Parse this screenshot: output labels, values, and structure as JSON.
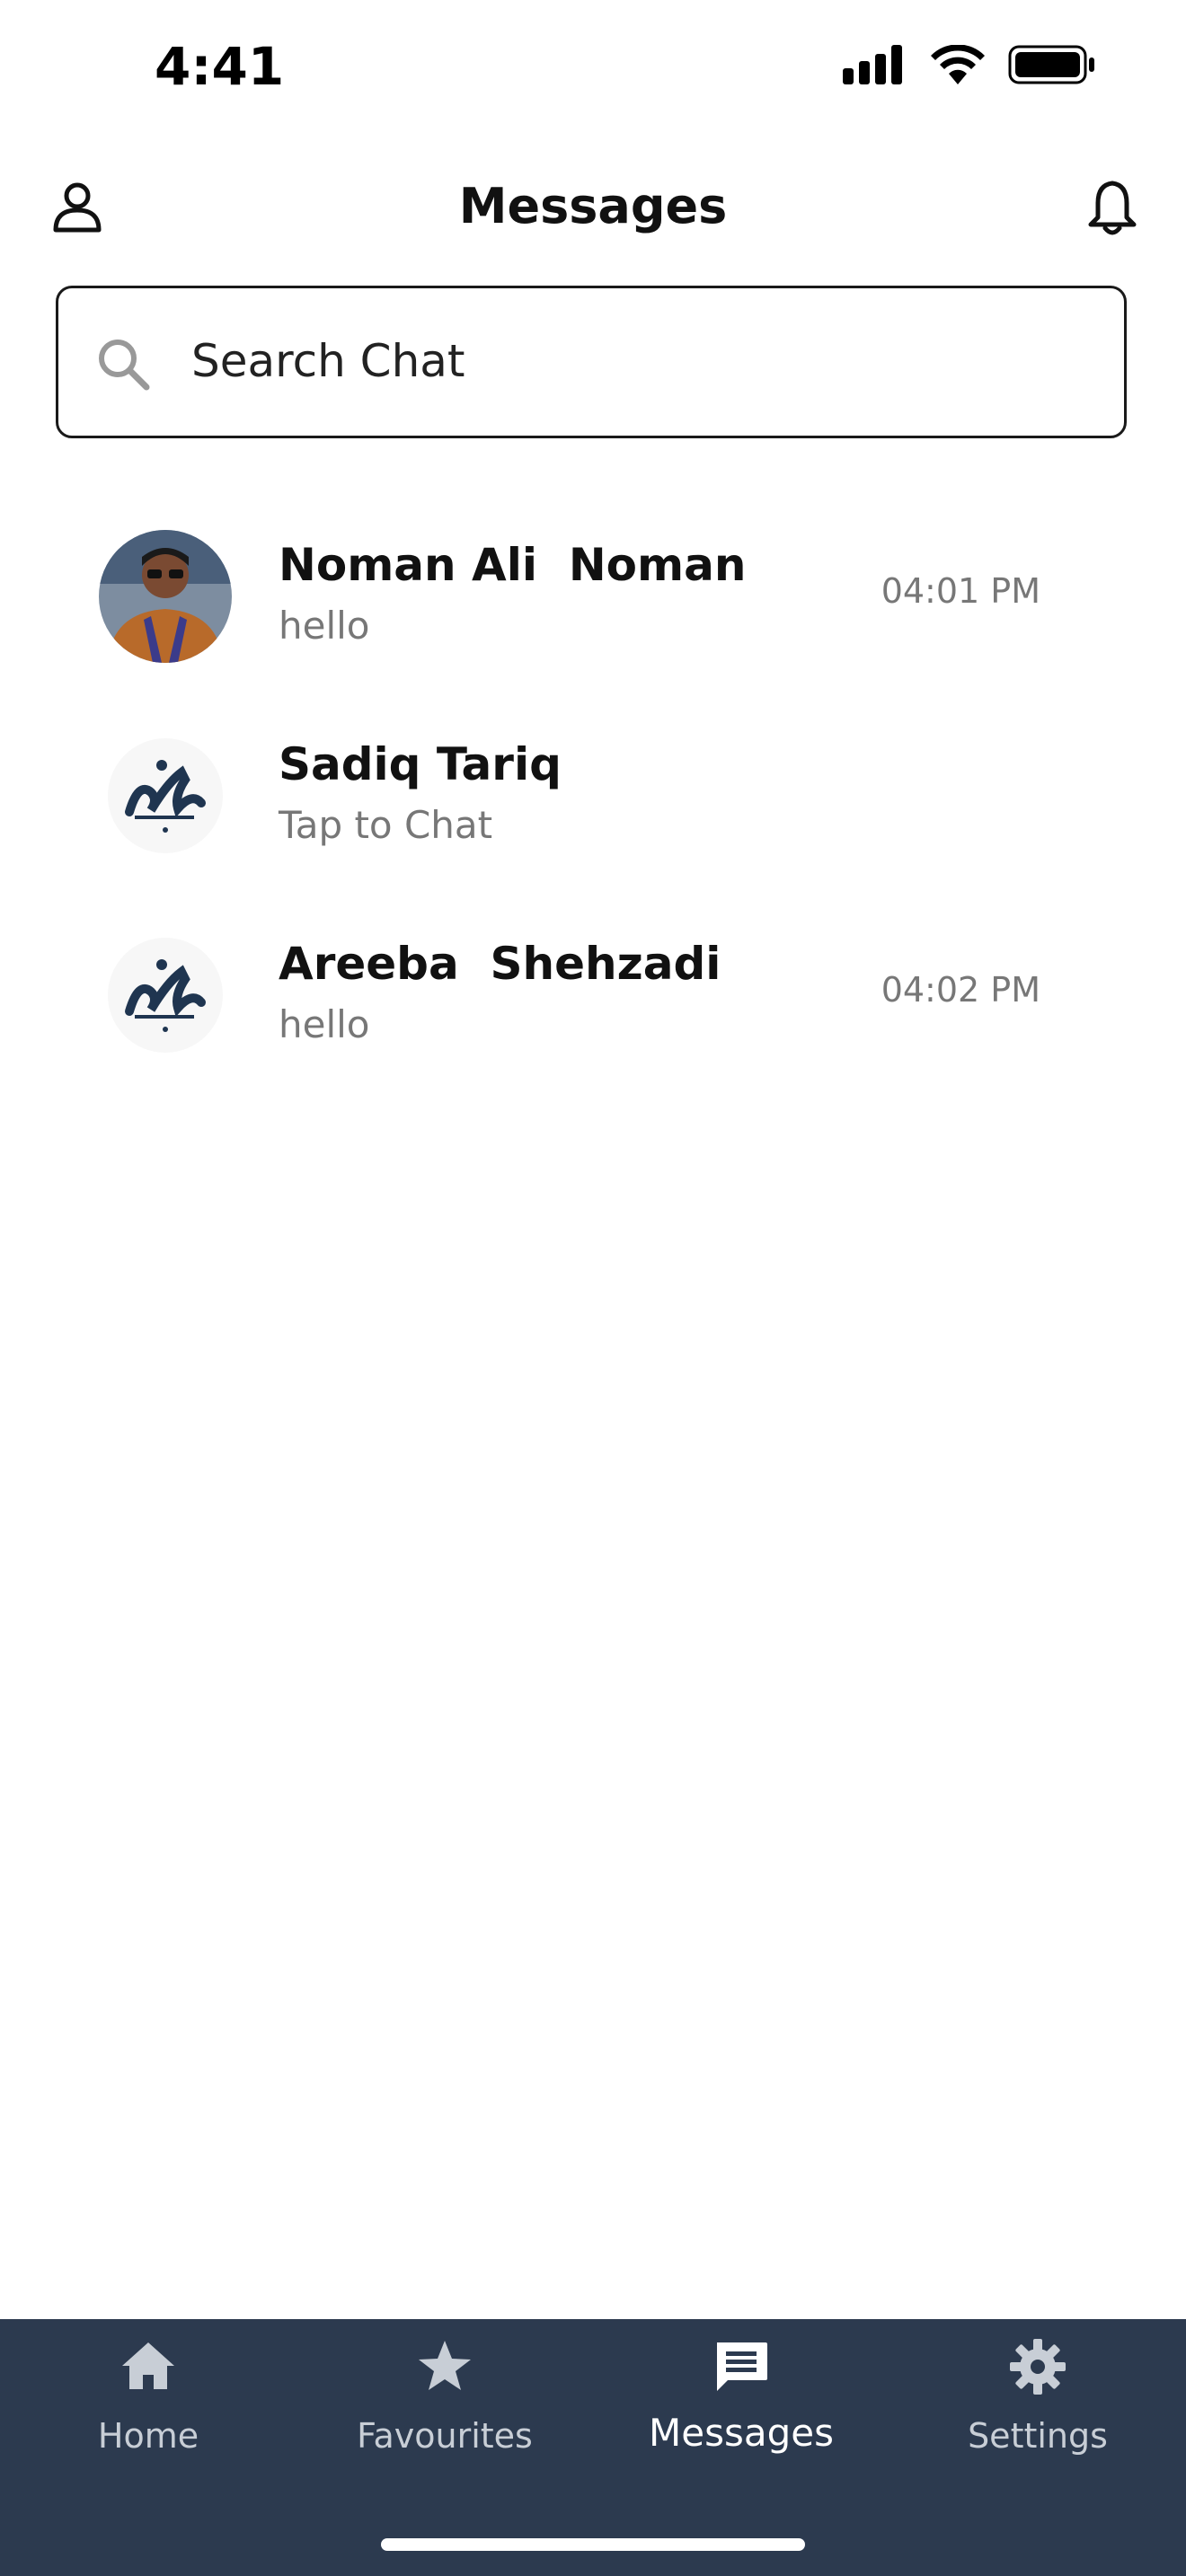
{
  "status_bar": {
    "time": "4:41"
  },
  "header": {
    "title": "Messages"
  },
  "search": {
    "placeholder": "Search Chat"
  },
  "chats": [
    {
      "name": "Noman Ali  Noman",
      "preview": "hello",
      "time": "04:01 PM"
    },
    {
      "name": "Sadiq Tariq",
      "preview": "Tap to Chat",
      "time": ""
    },
    {
      "name": "Areeba  Shehzadi",
      "preview": "hello",
      "time": "04:02 PM"
    }
  ],
  "tabs": [
    {
      "label": "Home",
      "icon": "home-icon"
    },
    {
      "label": "Favourites",
      "icon": "star-icon"
    },
    {
      "label": "Messages",
      "icon": "message-icon"
    },
    {
      "label": "Settings",
      "icon": "gear-icon"
    }
  ],
  "colors": {
    "tabbar_bg": "#2c3a4f",
    "tab_inactive": "#c8ced6",
    "tab_active": "#ffffff",
    "logo_navy": "#1f3550"
  }
}
